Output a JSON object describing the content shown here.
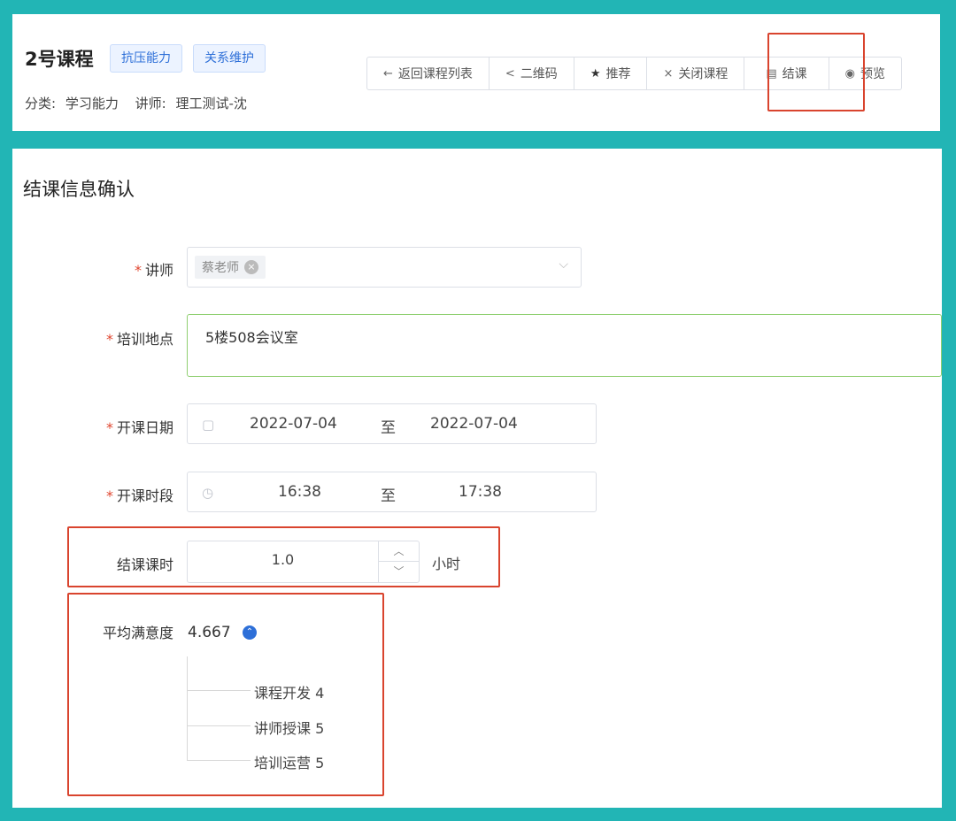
{
  "course": {
    "title": "2号课程",
    "tags": [
      "抗压能力",
      "关系维护"
    ],
    "category_label": "分类:",
    "category_value": "学习能力",
    "teacher_label": "讲师:",
    "teacher_value": "理工测试-沈"
  },
  "toolbar": {
    "back": {
      "icon": "←",
      "label": "返回课程列表"
    },
    "qrcode": {
      "icon": "<",
      "label": "二维码"
    },
    "recommend": {
      "icon": "★",
      "label": "推荐"
    },
    "close": {
      "icon": "×",
      "label": "关闭课程"
    },
    "conclude": {
      "icon": "▤",
      "label": "结课"
    },
    "preview": {
      "icon": "◉",
      "label": "预览"
    }
  },
  "form": {
    "section_title": "结课信息确认",
    "required_mark": "*",
    "teacher": {
      "label": "讲师",
      "chip": "蔡老师",
      "chip_remove": "×",
      "chevron": "⌵"
    },
    "location": {
      "label": "培训地点",
      "value": "5楼508会议室"
    },
    "date": {
      "label": "开课日期",
      "icon": "▢",
      "start": "2022-07-04",
      "separator": "至",
      "end": "2022-07-04"
    },
    "time": {
      "label": "开课时段",
      "icon": "◷",
      "start": "16:38",
      "separator": "至",
      "end": "17:38"
    },
    "hours": {
      "label": "结课课时",
      "value": "1.0",
      "up": "︿",
      "down": "﹀",
      "unit": "小时"
    },
    "satisfaction": {
      "label": "平均满意度",
      "score": "4.667",
      "toggle": "⌃",
      "items": [
        "课程开发 4",
        "讲师授课 5",
        "培训运营 5"
      ]
    }
  }
}
